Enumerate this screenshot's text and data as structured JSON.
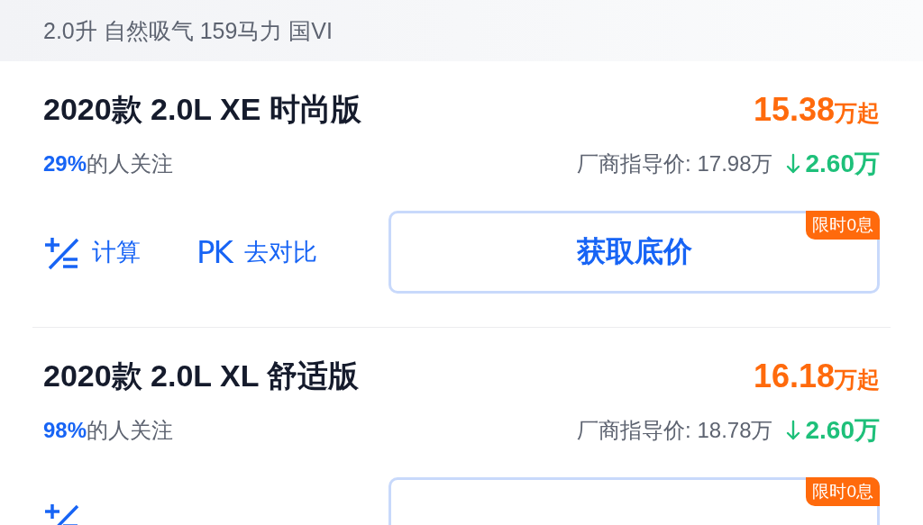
{
  "spec_bar": {
    "text": "2.0升 自然吸气 159马力 国VI"
  },
  "trims": [
    {
      "name": "2020款 2.0L XE 时尚版",
      "price": "15.38",
      "price_unit": "万起",
      "follow_percent": "29%",
      "follow_label": "的人关注",
      "guide_price": "厂商指导价: 17.98万",
      "discount": "2.60万",
      "calc_label": "计算",
      "compare_label": "去对比",
      "pk_mark": "PK",
      "cta": "获取底价",
      "badge": "限时0息"
    },
    {
      "name": "2020款 2.0L XL 舒适版",
      "price": "16.18",
      "price_unit": "万起",
      "follow_percent": "98%",
      "follow_label": "的人关注",
      "guide_price": "厂商指导价: 18.78万",
      "discount": "2.60万",
      "badge": "限时0息"
    }
  ]
}
